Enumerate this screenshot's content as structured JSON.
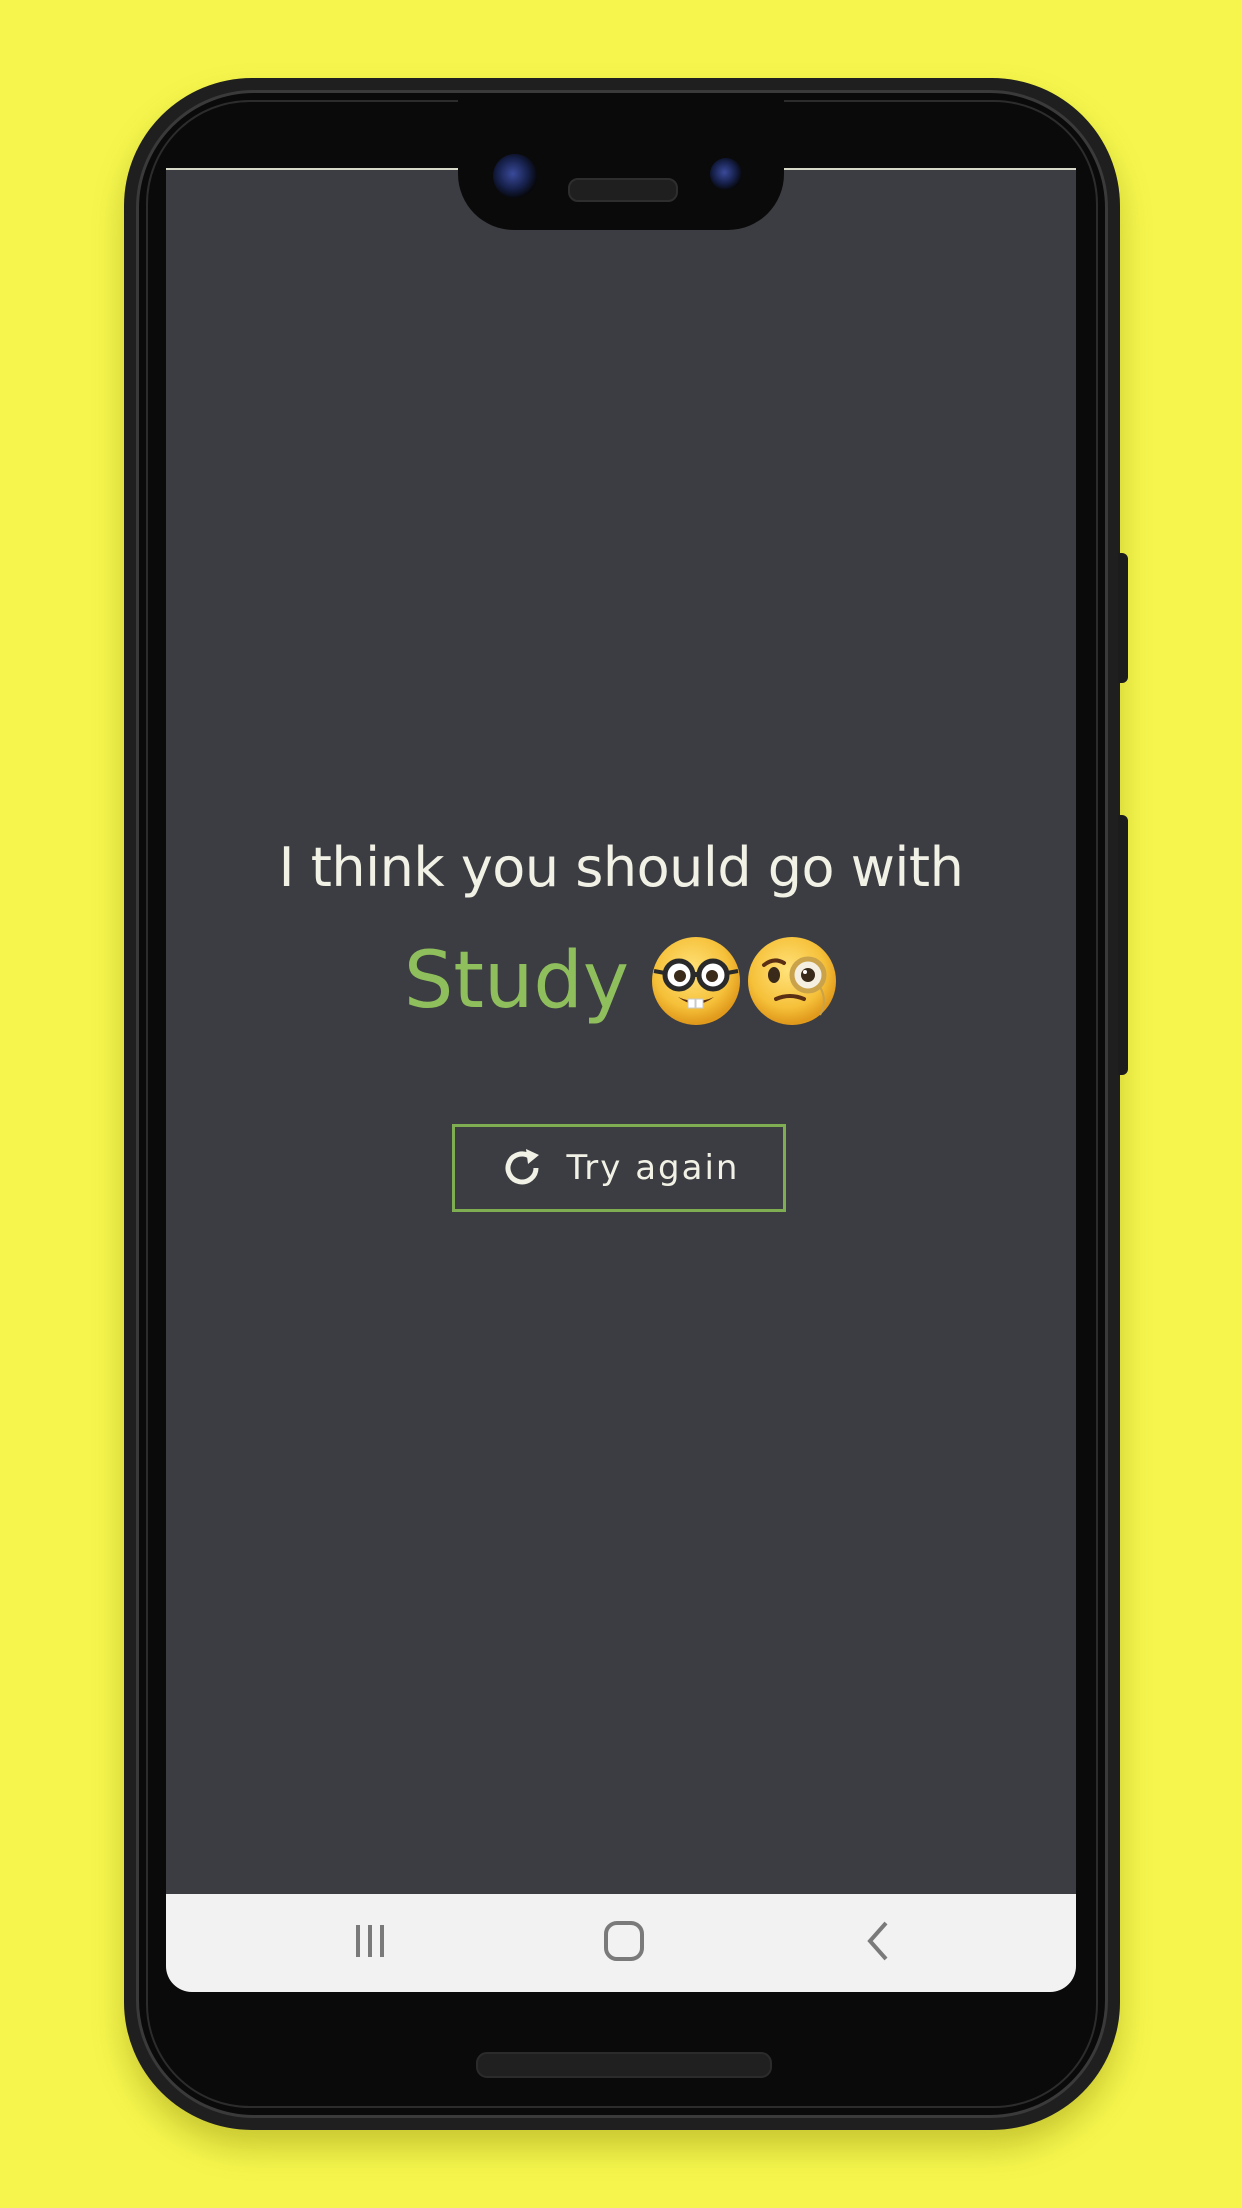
{
  "app": {
    "background_color": "#f5f54d",
    "screen_color": "#3c3d42",
    "accent_color": "#8fbf5c"
  },
  "content": {
    "headline": "I think you should go with",
    "result": "Study",
    "result_emojis": [
      "nerd-face-icon",
      "face-with-monocle-icon"
    ]
  },
  "actions": {
    "try_again_label": "Try again",
    "try_again_icon": "refresh-icon"
  },
  "navigation_bar": {
    "items": [
      {
        "name": "recents",
        "icon": "recent-apps-icon"
      },
      {
        "name": "home",
        "icon": "home-icon"
      },
      {
        "name": "back",
        "icon": "back-chevron-icon"
      }
    ]
  }
}
